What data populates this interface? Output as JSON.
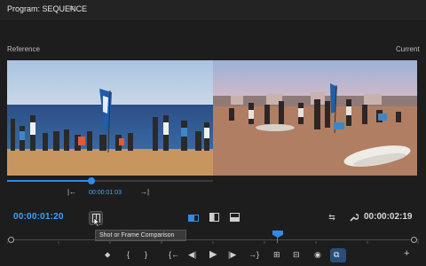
{
  "panel": {
    "title": "Program: SEQUENCE",
    "menu_icon": "hamburger-icon"
  },
  "compare": {
    "reference_label": "Reference",
    "current_label": "Current",
    "reference_timecode": "00:00:01:03"
  },
  "timecodes": {
    "playhead": "00:00:01:20",
    "duration": "00:00:02:19"
  },
  "tooltip": {
    "text": "Shot or Frame Comparison"
  },
  "colors": {
    "accent": "#2d8ceb",
    "timecode_blue": "#3ea0ff"
  },
  "icons": {
    "ref_prev_edit": "step-back-to-in-icon",
    "ref_next_edit": "step-forward-to-out-icon",
    "compare_button": "shot-frame-comparison-icon",
    "split_side_by_side": "side-by-side-icon",
    "split_vertical": "vertical-split-icon",
    "split_horizontal": "horizontal-split-icon",
    "swap_sides": "swap-icon",
    "settings": "wrench-icon"
  },
  "transport": {
    "buttons": [
      {
        "name": "add-marker-icon",
        "glyph": "⬥"
      },
      {
        "name": "mark-in-icon",
        "glyph": "{"
      },
      {
        "name": "mark-out-icon",
        "glyph": "}"
      },
      {
        "name": "go-to-in-icon",
        "glyph": "{←"
      },
      {
        "name": "step-back-icon",
        "glyph": "◀|"
      },
      {
        "name": "play-icon",
        "glyph": "▶"
      },
      {
        "name": "step-forward-icon",
        "glyph": "|▶"
      },
      {
        "name": "go-to-out-icon",
        "glyph": "→}"
      },
      {
        "name": "insert-icon",
        "glyph": "⊞"
      },
      {
        "name": "overwrite-icon",
        "glyph": "⊟"
      },
      {
        "name": "export-frame-icon",
        "glyph": "◉"
      },
      {
        "name": "comparison-view-icon",
        "glyph": "⧉"
      },
      {
        "name": "add-button-icon",
        "glyph": "+"
      }
    ]
  }
}
